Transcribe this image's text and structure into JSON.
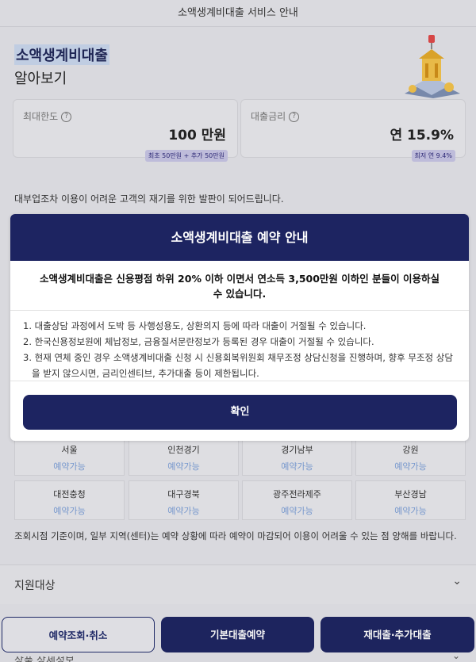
{
  "header": {
    "title": "소액생계비대출 서비스 안내"
  },
  "hero": {
    "title": "소액생계비대출",
    "subtitle": "알아보기",
    "cards": [
      {
        "label": "최대한도",
        "value": "100 만원",
        "badge": "최초 50만원 + 추가 50만원"
      },
      {
        "label": "대출금리",
        "value": "연 15.9%",
        "badge": "최저 연 9.4%"
      }
    ]
  },
  "description": "대부업조차 이용이 어려운 고객의 재기를 위한 발판이 되어드립니다.",
  "regions": [
    {
      "name": "서울",
      "status": "예약가능"
    },
    {
      "name": "인천경기",
      "status": "예약가능"
    },
    {
      "name": "경기남부",
      "status": "예약가능"
    },
    {
      "name": "강원",
      "status": "예약가능"
    },
    {
      "name": "대전충청",
      "status": "예약가능"
    },
    {
      "name": "대구경북",
      "status": "예약가능"
    },
    {
      "name": "광주전라제주",
      "status": "예약가능"
    },
    {
      "name": "부산경남",
      "status": "예약가능"
    }
  ],
  "note": "조회시점 기준이며, 일부 지역(센터)는 예약 상황에 따라 예약이 마감되어 이용이 어려울 수 있는 점 양해를 바랍니다.",
  "accordion": [
    {
      "label": "지원대상"
    },
    {
      "label": "상품 상세정보"
    }
  ],
  "bottom_buttons": {
    "inquiry": "예약조회·취소",
    "basic": "기본대출예약",
    "additional": "재대출·추가대출"
  },
  "modal": {
    "title": "소액생계비대출 예약 안내",
    "lead": "소액생계비대출은 신용평점 하위 20% 이하 이면서 연소득 3,500만원 이하인 분들이 이용하실 수 있습니다.",
    "items": [
      "1. 대출상담 과정에서 도박 등 사행성용도, 상환의지 등에 따라 대출이 거절될 수 있습니다.",
      "2. 한국신용정보원에 체납정보, 금융질서문란정보가 등록된 경우 대출이 거절될 수 있습니다.",
      "3. 현재 연체 중인 경우 소액생계비대출 신청 시 신용회복위원회 채무조정 상담신청을 진행하며, 향후 무조정 상담을 받지 않으시면, 금리인센티브, 추가대출 등이 제한됩니다."
    ],
    "confirm": "확인"
  },
  "colors": {
    "primary": "#1d2461",
    "available": "#7b9ed6"
  }
}
